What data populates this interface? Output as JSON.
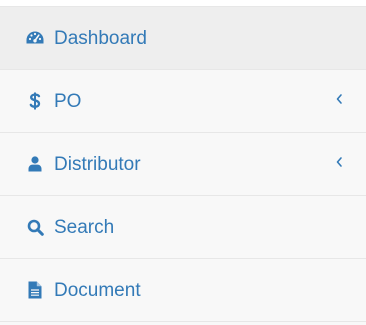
{
  "sidebar": {
    "accent_color": "#337ab7",
    "items": [
      {
        "label": "Dashboard",
        "icon": "dashboard-icon",
        "active": true,
        "has_submenu": false
      },
      {
        "label": "PO",
        "icon": "dollar-icon",
        "active": false,
        "has_submenu": true
      },
      {
        "label": "Distributor",
        "icon": "user-icon",
        "active": false,
        "has_submenu": true
      },
      {
        "label": "Search",
        "icon": "search-icon",
        "active": false,
        "has_submenu": false
      },
      {
        "label": "Document",
        "icon": "document-icon",
        "active": false,
        "has_submenu": false
      }
    ]
  }
}
